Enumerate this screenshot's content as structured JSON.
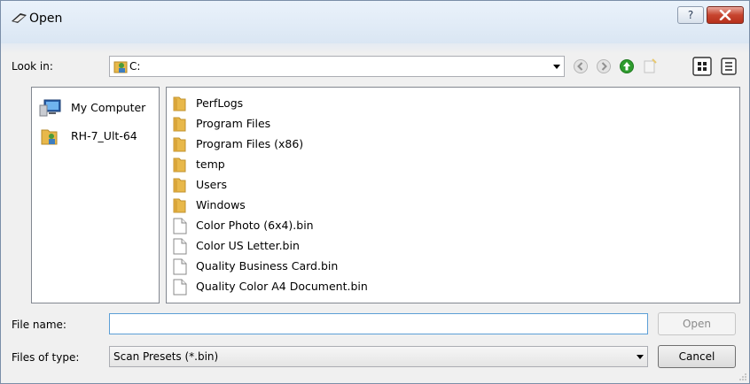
{
  "window": {
    "title": "Open"
  },
  "titlebar": {
    "help_label": "?",
    "close_label": "x"
  },
  "lookin": {
    "label": "Look in:",
    "value": "C:"
  },
  "places": [
    {
      "label": "My Computer",
      "icon": "computer-icon"
    },
    {
      "label": "RH-7_Ult-64",
      "icon": "user-folder-icon"
    }
  ],
  "files": [
    {
      "name": "PerfLogs",
      "type": "folder"
    },
    {
      "name": "Program Files",
      "type": "folder"
    },
    {
      "name": "Program Files (x86)",
      "type": "folder"
    },
    {
      "name": "temp",
      "type": "folder"
    },
    {
      "name": "Users",
      "type": "folder"
    },
    {
      "name": "Windows",
      "type": "folder"
    },
    {
      "name": "Color Photo (6x4).bin",
      "type": "file"
    },
    {
      "name": "Color US Letter.bin",
      "type": "file"
    },
    {
      "name": "Quality Business Card.bin",
      "type": "file"
    },
    {
      "name": "Quality Color A4 Document.bin",
      "type": "file"
    }
  ],
  "filename": {
    "label": "File name:",
    "value": "",
    "placeholder": ""
  },
  "filetype": {
    "label": "Files of type:",
    "value": "Scan Presets (*.bin)"
  },
  "buttons": {
    "open": "Open",
    "cancel": "Cancel"
  },
  "colors": {
    "folder": "#e8b84a",
    "accent_green": "#2e9c2e",
    "close_red": "#c7442f"
  }
}
